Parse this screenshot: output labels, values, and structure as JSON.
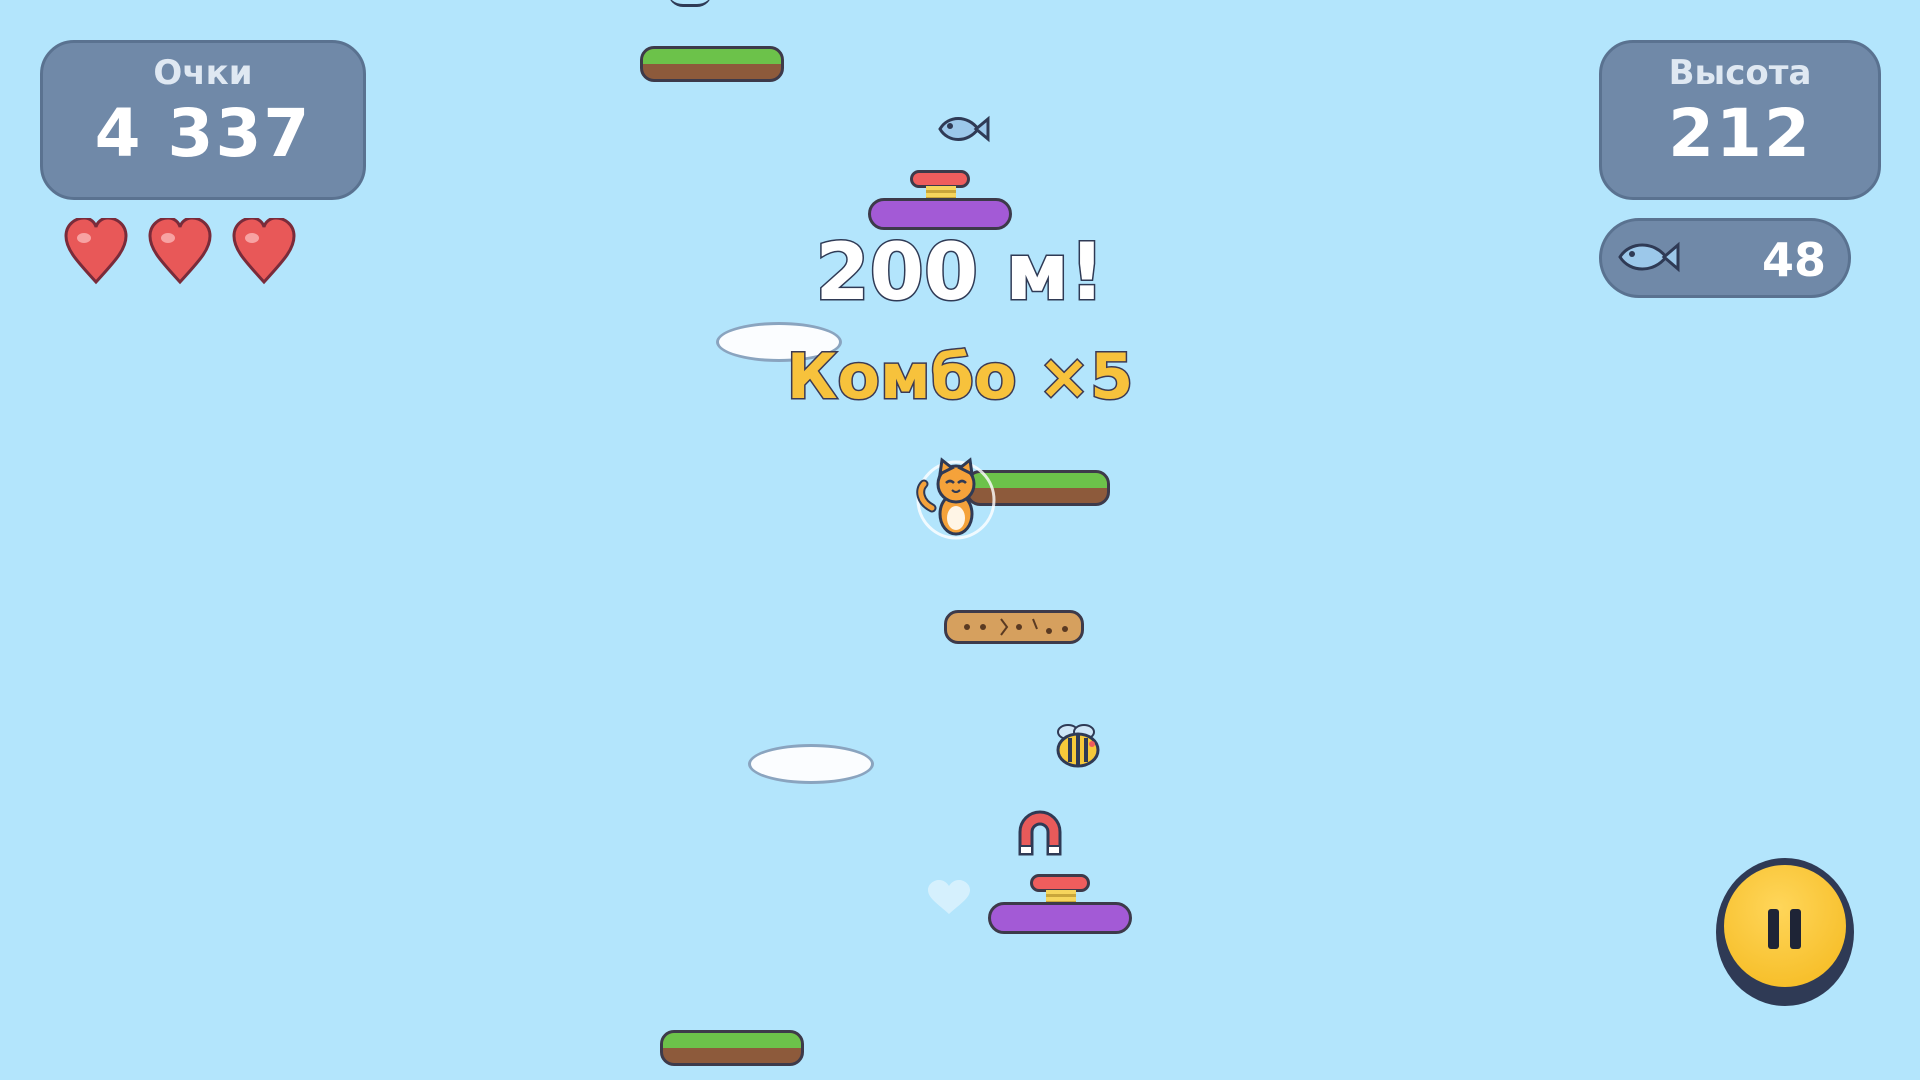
{
  "hud": {
    "score_label": "Очки",
    "score_value": "4 337",
    "height_label": "Высота",
    "height_value": "212",
    "fish_count": "48",
    "fish_icon": "fish-icon",
    "lives": 3,
    "heart_icon": "heart-icon"
  },
  "messages": {
    "milestone": "200 м!",
    "combo": "Комбо ×5"
  },
  "controls": {
    "pause_icon": "pause-icon"
  },
  "colors": {
    "sky": "#b3e5fc",
    "panel": "#7089a8",
    "combo_text": "#f7c23c",
    "pause_button": "#f4b81c",
    "heart": "#e85858"
  }
}
